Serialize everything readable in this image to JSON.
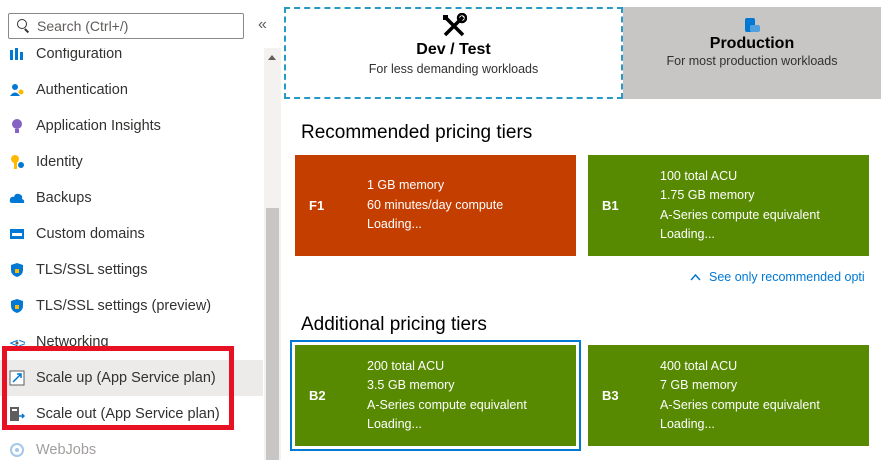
{
  "sidebar": {
    "search_placeholder": "Search (Ctrl+/)",
    "collapse_label": "«",
    "items": [
      {
        "label": "Configuration",
        "icon": "configuration-icon"
      },
      {
        "label": "Authentication",
        "icon": "authentication-icon"
      },
      {
        "label": "Application Insights",
        "icon": "application-insights-icon"
      },
      {
        "label": "Identity",
        "icon": "identity-icon"
      },
      {
        "label": "Backups",
        "icon": "backups-icon"
      },
      {
        "label": "Custom domains",
        "icon": "custom-domains-icon"
      },
      {
        "label": "TLS/SSL settings",
        "icon": "tls-ssl-icon"
      },
      {
        "label": "TLS/SSL settings (preview)",
        "icon": "tls-ssl-preview-icon"
      },
      {
        "label": "Networking",
        "icon": "networking-icon"
      },
      {
        "label": "Scale up (App Service plan)",
        "icon": "scale-up-icon",
        "selected": true
      },
      {
        "label": "Scale out (App Service plan)",
        "icon": "scale-out-icon"
      },
      {
        "label": "WebJobs",
        "icon": "webjobs-icon"
      }
    ]
  },
  "tabs": {
    "dev": {
      "title": "Dev / Test",
      "subtitle": "For less demanding workloads",
      "icon": "tools-icon"
    },
    "prod": {
      "title": "Production",
      "subtitle": "For most production workloads",
      "icon": "production-icon"
    }
  },
  "recommended": {
    "title": "Recommended pricing tiers",
    "tiers": [
      {
        "code": "F1",
        "lines": [
          "1 GB memory",
          "60 minutes/day compute",
          "Loading..."
        ],
        "color": "#c43e00"
      },
      {
        "code": "B1",
        "lines": [
          "100 total ACU",
          "1.75 GB memory",
          "A-Series compute equivalent",
          "Loading..."
        ],
        "color": "#578a00"
      }
    ],
    "link": "See only recommended opti"
  },
  "additional": {
    "title": "Additional pricing tiers",
    "tiers": [
      {
        "code": "B2",
        "lines": [
          "200 total ACU",
          "3.5 GB memory",
          "A-Series compute equivalent",
          "Loading..."
        ],
        "color": "#578a00",
        "selected": true
      },
      {
        "code": "B3",
        "lines": [
          "400 total ACU",
          "7 GB memory",
          "A-Series compute equivalent",
          "Loading..."
        ],
        "color": "#578a00"
      }
    ]
  },
  "colors": {
    "accent": "#0078d4",
    "highlight": "#e81123"
  }
}
